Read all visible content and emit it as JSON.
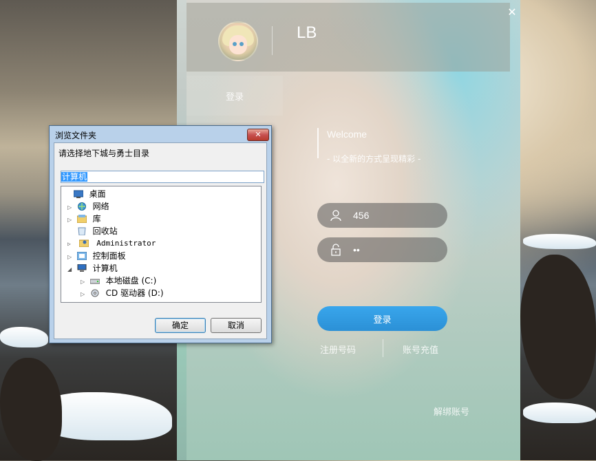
{
  "app": {
    "username": "LB",
    "close_symbol": "✕",
    "side_tab_label": "登录",
    "welcome_title": "Welcome",
    "welcome_subtitle": "-  以全新的方式呈现精彩  -",
    "username_value": "456",
    "password_value": "••",
    "login_button": "登录",
    "register_link": "注册号码",
    "recharge_link": "账号充值",
    "unbind_link": "解绑账号",
    "icons": [
      "user-icon",
      "lock-icon",
      "close-icon"
    ],
    "accent_color": "#2b90d6"
  },
  "dialog": {
    "title": "浏览文件夹",
    "close_symbol": "✕",
    "instruction": "请选择地下城与勇士目录",
    "selected_path": "计算机",
    "tree": [
      {
        "label": "桌面",
        "icon": "desktop-icon",
        "arrow": ""
      },
      {
        "label": "网络",
        "icon": "network-icon",
        "arrow": "▷"
      },
      {
        "label": "库",
        "icon": "library-icon",
        "arrow": "▷"
      },
      {
        "label": "回收站",
        "icon": "recycle-bin-icon",
        "arrow": ""
      },
      {
        "label": "Administrator",
        "icon": "user-folder-icon",
        "arrow": "▷"
      },
      {
        "label": "控制面板",
        "icon": "control-panel-icon",
        "arrow": "▷"
      },
      {
        "label": "计算机",
        "icon": "computer-icon",
        "arrow": "◢"
      },
      {
        "label": "本地磁盘 (C:)",
        "icon": "drive-icon",
        "arrow": "▷"
      },
      {
        "label": "CD 驱动器 (D:)",
        "icon": "cd-drive-icon",
        "arrow": "▷"
      }
    ],
    "ok_button": "确定",
    "cancel_button": "取消"
  }
}
